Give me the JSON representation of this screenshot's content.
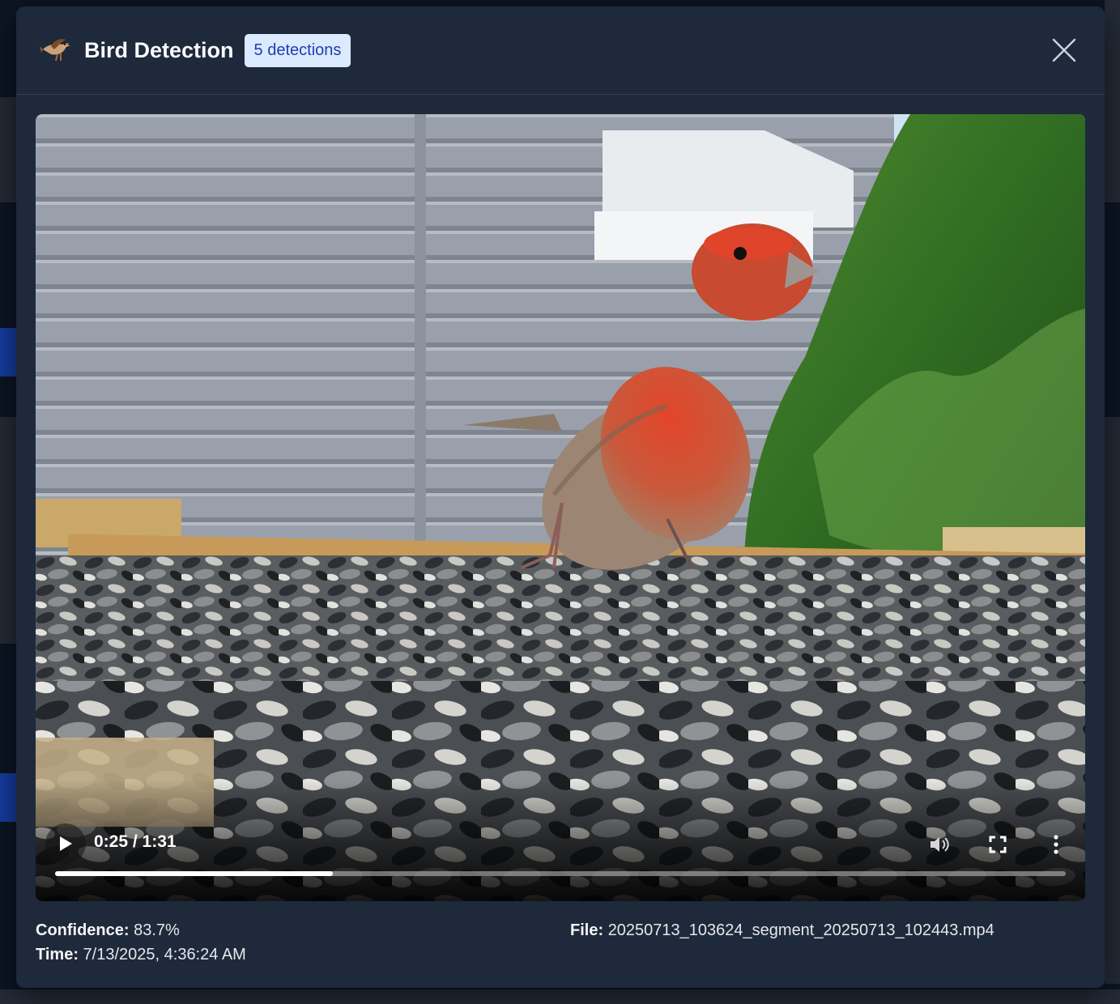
{
  "modal": {
    "title": "Bird Detection",
    "badge": "5 detections",
    "icon": "bird-icon",
    "close_icon": "close-icon"
  },
  "video": {
    "current_time": "0:25",
    "duration": "1:31",
    "time_readout": "0:25 / 1:31",
    "progress_fraction": 0.275,
    "controls": [
      "play-icon",
      "volume-icon",
      "fullscreen-icon",
      "more-vert-icon"
    ]
  },
  "details": {
    "confidence_label": "Confidence:",
    "confidence_value": "83.7%",
    "time_label": "Time:",
    "time_value": "7/13/2025, 4:36:24 AM",
    "file_label": "File:",
    "file_value": "20250713_103624_segment_20250713_102443.mp4"
  },
  "colors": {
    "modal_bg": "#1e293b",
    "badge_bg": "#dbeafe",
    "badge_text": "#1e40af",
    "bird_red": "#d9462a"
  }
}
